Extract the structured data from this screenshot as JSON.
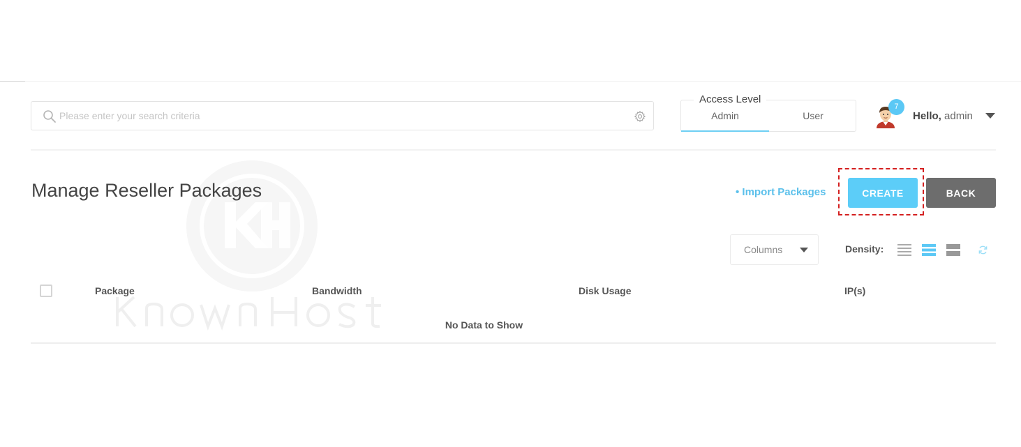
{
  "search": {
    "placeholder": "Please enter your search criteria",
    "value": ""
  },
  "access_level": {
    "legend": "Access Level",
    "options": [
      "Admin",
      "User"
    ],
    "selected": "Admin",
    "accent": "#6ecff3"
  },
  "user": {
    "notification_count": "7",
    "greeting": "Hello,",
    "name": "admin"
  },
  "header": {
    "title": "Manage Reseller Packages",
    "import_label": "Import Packages",
    "create_label": "CREATE",
    "back_label": "BACK",
    "create_color": "#5ccdf8",
    "back_color": "#6d6d6d"
  },
  "toolbar": {
    "columns_label": "Columns",
    "density_label": "Density:",
    "density_options": [
      "compact-density-icon",
      "standard-density-icon",
      "comfortable-density-icon"
    ],
    "density_selected": "standard-density-icon"
  },
  "table": {
    "columns": [
      "Package",
      "Bandwidth",
      "Disk Usage",
      "IP(s)"
    ],
    "rows": [],
    "empty_message": "No Data to Show"
  },
  "watermark": {
    "text": "KnownHost"
  }
}
